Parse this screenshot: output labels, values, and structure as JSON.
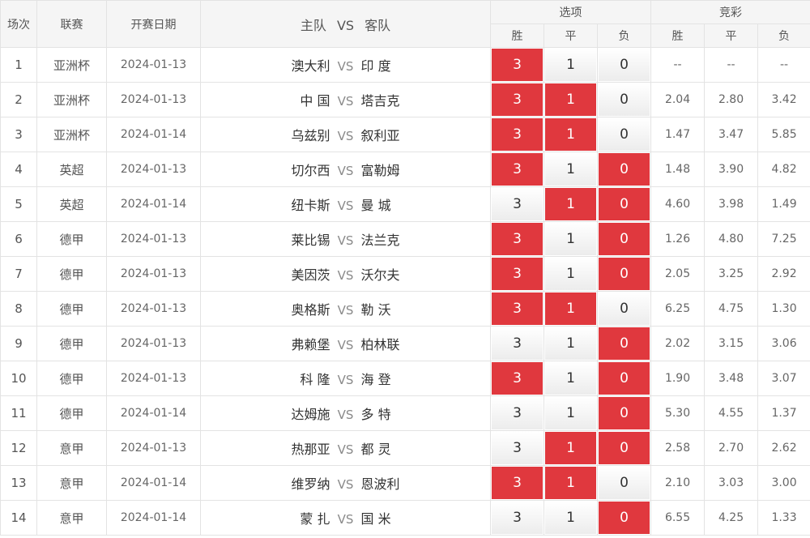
{
  "colors": {
    "selected": "#e0383e",
    "header_bg": "#f5f5f5",
    "border": "#e3e3e3"
  },
  "header": {
    "col_no": "场次",
    "col_league": "联赛",
    "col_date": "开赛日期",
    "col_home": "主队",
    "col_vs": "VS",
    "col_away": "客队",
    "group_options": "选项",
    "group_odds": "竞彩",
    "win": "胜",
    "draw": "平",
    "loss": "负"
  },
  "vs_label": "VS",
  "option_labels": {
    "win": "3",
    "draw": "1",
    "loss": "0"
  },
  "rows": [
    {
      "no": "1",
      "league": "亚洲杯",
      "date": "2024-01-13",
      "home": "澳大利",
      "away": "印 度",
      "sel": [
        true,
        false,
        false
      ],
      "odds": [
        "--",
        "--",
        "--"
      ]
    },
    {
      "no": "2",
      "league": "亚洲杯",
      "date": "2024-01-13",
      "home": "中 国",
      "away": "塔吉克",
      "sel": [
        true,
        true,
        false
      ],
      "odds": [
        "2.04",
        "2.80",
        "3.42"
      ]
    },
    {
      "no": "3",
      "league": "亚洲杯",
      "date": "2024-01-14",
      "home": "乌兹别",
      "away": "叙利亚",
      "sel": [
        true,
        true,
        false
      ],
      "odds": [
        "1.47",
        "3.47",
        "5.85"
      ]
    },
    {
      "no": "4",
      "league": "英超",
      "date": "2024-01-13",
      "home": "切尔西",
      "away": "富勒姆",
      "sel": [
        true,
        false,
        true
      ],
      "odds": [
        "1.48",
        "3.90",
        "4.82"
      ]
    },
    {
      "no": "5",
      "league": "英超",
      "date": "2024-01-14",
      "home": "纽卡斯",
      "away": "曼 城",
      "sel": [
        false,
        true,
        true
      ],
      "odds": [
        "4.60",
        "3.98",
        "1.49"
      ]
    },
    {
      "no": "6",
      "league": "德甲",
      "date": "2024-01-13",
      "home": "莱比锡",
      "away": "法兰克",
      "sel": [
        true,
        false,
        true
      ],
      "odds": [
        "1.26",
        "4.80",
        "7.25"
      ]
    },
    {
      "no": "7",
      "league": "德甲",
      "date": "2024-01-13",
      "home": "美因茨",
      "away": "沃尔夫",
      "sel": [
        true,
        false,
        true
      ],
      "odds": [
        "2.05",
        "3.25",
        "2.92"
      ]
    },
    {
      "no": "8",
      "league": "德甲",
      "date": "2024-01-13",
      "home": "奥格斯",
      "away": "勒 沃",
      "sel": [
        true,
        true,
        false
      ],
      "odds": [
        "6.25",
        "4.75",
        "1.30"
      ]
    },
    {
      "no": "9",
      "league": "德甲",
      "date": "2024-01-13",
      "home": "弗赖堡",
      "away": "柏林联",
      "sel": [
        false,
        false,
        true
      ],
      "odds": [
        "2.02",
        "3.15",
        "3.06"
      ]
    },
    {
      "no": "10",
      "league": "德甲",
      "date": "2024-01-13",
      "home": "科 隆",
      "away": "海 登",
      "sel": [
        true,
        false,
        true
      ],
      "odds": [
        "1.90",
        "3.48",
        "3.07"
      ]
    },
    {
      "no": "11",
      "league": "德甲",
      "date": "2024-01-14",
      "home": "达姆施",
      "away": "多 特",
      "sel": [
        false,
        false,
        true
      ],
      "odds": [
        "5.30",
        "4.55",
        "1.37"
      ]
    },
    {
      "no": "12",
      "league": "意甲",
      "date": "2024-01-13",
      "home": "热那亚",
      "away": "都 灵",
      "sel": [
        false,
        true,
        true
      ],
      "odds": [
        "2.58",
        "2.70",
        "2.62"
      ]
    },
    {
      "no": "13",
      "league": "意甲",
      "date": "2024-01-14",
      "home": "维罗纳",
      "away": "恩波利",
      "sel": [
        true,
        true,
        false
      ],
      "odds": [
        "2.10",
        "3.03",
        "3.00"
      ]
    },
    {
      "no": "14",
      "league": "意甲",
      "date": "2024-01-14",
      "home": "蒙 扎",
      "away": "国 米",
      "sel": [
        false,
        false,
        true
      ],
      "odds": [
        "6.55",
        "4.25",
        "1.33"
      ]
    }
  ]
}
